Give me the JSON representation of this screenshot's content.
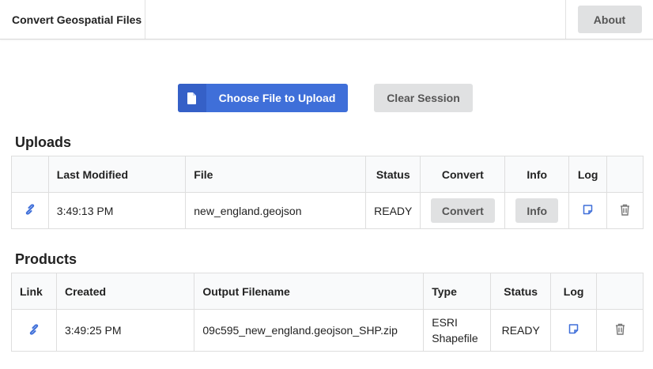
{
  "header": {
    "title": "Convert Geospatial Files",
    "about_label": "About"
  },
  "actions": {
    "upload_label": "Choose File to Upload",
    "clear_label": "Clear Session"
  },
  "uploads": {
    "title": "Uploads",
    "columns": [
      "",
      "Last Modified",
      "File",
      "Status",
      "Convert",
      "Info",
      "Log",
      ""
    ],
    "rows": [
      {
        "last_modified": "3:49:13 PM",
        "file": "new_england.geojson",
        "status": "READY",
        "convert_label": "Convert",
        "info_label": "Info"
      }
    ]
  },
  "products": {
    "title": "Products",
    "columns": [
      "Link",
      "Created",
      "Output Filename",
      "Type",
      "Status",
      "Log",
      ""
    ],
    "rows": [
      {
        "created": "3:49:25 PM",
        "filename": "09c595_new_england.geojson_SHP.zip",
        "type_line1": "ESRI",
        "type_line2": "Shapefile",
        "status": "READY"
      }
    ]
  },
  "colors": {
    "primary": "#3f6fd9",
    "button_grey": "#e0e1e2"
  },
  "icons": [
    "file-icon",
    "link-icon",
    "log-icon",
    "trash-icon"
  ]
}
